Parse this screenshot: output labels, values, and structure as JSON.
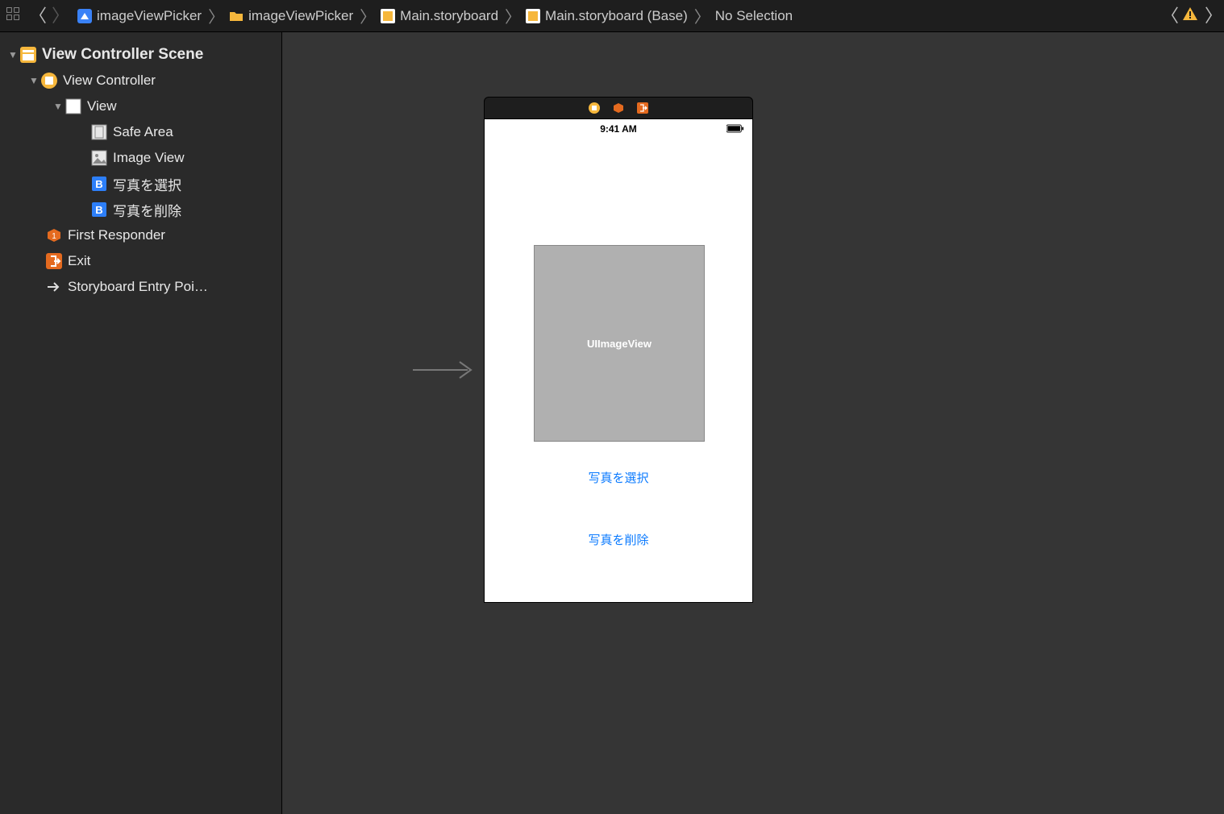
{
  "breadcrumb": [
    {
      "label": "imageViewPicker",
      "icon": "project"
    },
    {
      "label": "imageViewPicker",
      "icon": "folder"
    },
    {
      "label": "Main.storyboard",
      "icon": "storyboard"
    },
    {
      "label": "Main.storyboard (Base)",
      "icon": "storyboard"
    },
    {
      "label": "No Selection",
      "icon": ""
    }
  ],
  "outline": {
    "scene": "View Controller Scene",
    "vc": "View Controller",
    "view": "View",
    "safe_area": "Safe Area",
    "image_view": "Image View",
    "btn_select": "写真を選択",
    "btn_delete": "写真を削除",
    "first_responder": "First Responder",
    "exit": "Exit",
    "entry_point": "Storyboard Entry Poi…"
  },
  "device": {
    "time": "9:41 AM",
    "imageview_placeholder": "UIImageView",
    "btn_select": "写真を選択",
    "btn_delete": "写真を削除"
  }
}
